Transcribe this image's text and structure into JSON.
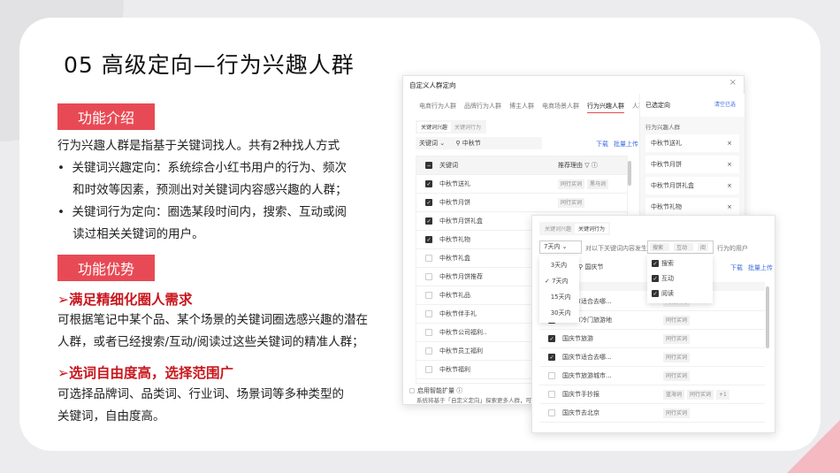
{
  "slide": {
    "title": "05  高级定向—行为兴趣人群",
    "intro_tag": "功能介绍",
    "intro_lines": [
      "行为兴趣人群是指基于关键词找人。共有2种找人方式",
      "•  关键词兴趣定向：系统综合小红书用户的行为、频次",
      "    和时效等因素，预测出对关键词内容感兴趣的人群；",
      "•  关键词行为定向：圈选某段时间内，搜索、互动或阅",
      "    读过相关关键词的用户。"
    ],
    "adv_tag": "功能优势",
    "adv1_title": "➢满足精细化圈人需求",
    "adv1_lines": [
      "可根据笔记中某个品、某个场景的关键词圈选感兴趣的潜在",
      "人群，或者已经搜索/互动/阅读过这些关键词的精准人群；"
    ],
    "adv2_title": "➢选词自由度高，选择范围广",
    "adv2_lines": [
      "可选择品牌词、品类词、行业词、场景词等多种类型的",
      "关键词，自由度高。"
    ]
  },
  "dialog1": {
    "title": "自定义人群定向",
    "close": "×",
    "tabs": [
      "电商行为人群",
      "品牌行为人群",
      "博主人群",
      "电商场景人群",
      "行为兴趣人群",
      "人群包"
    ],
    "subtabs": [
      "关键词兴趣",
      "关键词行为"
    ],
    "filter": "关键词 ⌄",
    "search": "中秋节",
    "download": "下载",
    "upload": "批量上传",
    "col_keyword": "关键词",
    "col_reason": "推荐理由 ▽ ⓘ",
    "rows": [
      {
        "k": "中秋节送礼",
        "on": true,
        "r": [
          "同行买词",
          "黑马词"
        ]
      },
      {
        "k": "中秋节月饼",
        "on": true,
        "r": [
          "同行买词"
        ]
      },
      {
        "k": "中秋节月饼礼盒",
        "on": true,
        "r": [
          "同行买词"
        ]
      },
      {
        "k": "中秋节礼物",
        "on": true,
        "r": []
      },
      {
        "k": "中秋节礼盒",
        "on": false,
        "r": []
      },
      {
        "k": "中秋节月饼推荐",
        "on": false,
        "r": []
      },
      {
        "k": "中秋节礼品",
        "on": false,
        "r": []
      },
      {
        "k": "中秋节伴手礼",
        "on": false,
        "r": []
      },
      {
        "k": "中秋节公司福利..",
        "on": false,
        "r": []
      },
      {
        "k": "中秋节员工福利",
        "on": false,
        "r": []
      },
      {
        "k": "中秋节福利",
        "on": false,
        "r": []
      }
    ],
    "selected_title": "已选定向",
    "clear": "清空已选",
    "selected_group": "行为兴趣人群",
    "selected": [
      "中秋节送礼",
      "中秋节月饼",
      "中秋节月饼礼盒",
      "中秋节礼物"
    ],
    "smart": "启用智能扩量 ⓘ",
    "smart_desc": "系统将基于「自定义定向」探索更多人群，可提"
  },
  "dialog2": {
    "subtabs": [
      "关键词兴趣",
      "关键词行为"
    ],
    "period": "7天内 ⌄",
    "mid": "对以下关键词内容发生",
    "actions_tags": [
      "搜索 ×",
      "互动 ×",
      "阅"
    ],
    "suffix": "行为的用户",
    "period_options": [
      "3天内",
      "7天内",
      "15天内",
      "30天内"
    ],
    "period_selected": "7天内",
    "action_options": [
      "搜索",
      "互动",
      "阅读"
    ],
    "search": "国庆节",
    "download": "下载",
    "upload": "批量上传",
    "rows": [
      {
        "k": "国庆节适合去哪...",
        "on": true,
        "r": [
          "同行买词"
        ]
      },
      {
        "k": "国庆节冷门旅游地",
        "on": true,
        "r": [
          "同行买词"
        ]
      },
      {
        "k": "国庆节旅游",
        "on": true,
        "r": [
          "同行买词"
        ]
      },
      {
        "k": "国庆节适合去哪...",
        "on": true,
        "r": [
          "同行买词"
        ]
      },
      {
        "k": "国庆节旅游城市...",
        "on": false,
        "r": [
          "同行买词"
        ]
      },
      {
        "k": "国庆节手抄报",
        "on": false,
        "r": [
          "蓝海词",
          "同行买词",
          "+1"
        ]
      },
      {
        "k": "国庆节去北京",
        "on": false,
        "r": [
          "同行买词"
        ]
      }
    ]
  }
}
